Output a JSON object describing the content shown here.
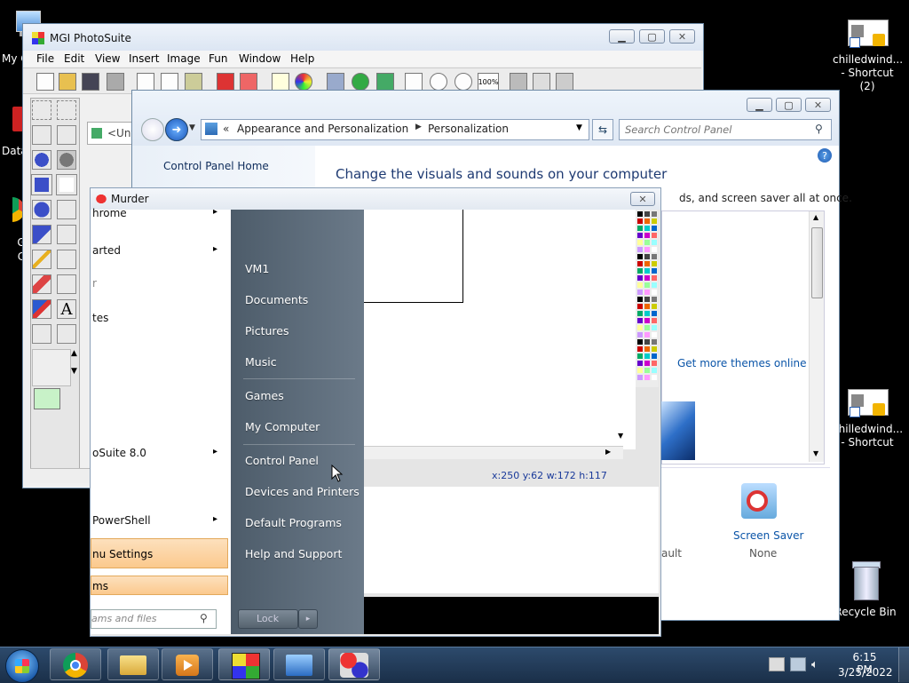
{
  "desktop": {
    "icons": [
      {
        "label": "My C",
        "id": "computer"
      },
      {
        "label": "Data",
        "id": "data"
      },
      {
        "label": "G C",
        "id": "chrome"
      },
      {
        "label": "chilledwind... - Shortcut (2)",
        "line1": "chilledwind...",
        "line2": "- Shortcut (2)"
      },
      {
        "label": "chilledwind... - Shortcut",
        "line1": "chilledwind...",
        "line2": "- Shortcut"
      },
      {
        "label": "Recycle Bin"
      }
    ]
  },
  "photosuite": {
    "title": "MGI PhotoSuite",
    "menu": [
      "File",
      "Edit",
      "View",
      "Insert",
      "Image",
      "Fun",
      "Window",
      "Help"
    ],
    "doc_tab": "<Unt",
    "status": "x:250 y:62  w:172 h:117",
    "zoom_label": "100%"
  },
  "control_panel": {
    "breadcrumb_prefix": "«",
    "breadcrumb": [
      "Appearance and Personalization",
      "Personalization"
    ],
    "search_placeholder": "Search Control Panel",
    "home_link": "Control Panel Home",
    "heading": "Change the visuals and sounds on your computer",
    "subtext": "ds, and screen saver all at once.",
    "more_themes": "Get more themes online",
    "screen_saver_label": "Screen Saver",
    "screen_saver_value": "None",
    "partial_text": "ault"
  },
  "murder_window": {
    "title": "Murder"
  },
  "start_menu": {
    "left_items": [
      {
        "label": "hrome",
        "arrow": "▸"
      },
      {
        "label": "arted",
        "arrow": "▸"
      },
      {
        "label": "r"
      },
      {
        "label": "tes"
      },
      {
        "label": "oSuite 8.0",
        "arrow": "▸"
      },
      {
        "label": "PowerShell",
        "arrow": "▸"
      },
      {
        "label": "nu Settings"
      },
      {
        "label": "ms"
      }
    ],
    "search_placeholder": "ams and files",
    "right_items": [
      "VM1",
      "Documents",
      "Pictures",
      "Music",
      "Games",
      "My Computer",
      "Control Panel",
      "Devices and Printers",
      "Default Programs",
      "Help and Support"
    ],
    "lock_label": "Lock"
  },
  "taskbar": {
    "time": "6:15 PM",
    "date": "3/25/2022"
  },
  "colors": {
    "taskbar": "#1f3650",
    "startmenu": "#5f6e7d",
    "link": "#0b55a8",
    "heading": "#1e3a72",
    "highlight": "#fbc98d"
  }
}
